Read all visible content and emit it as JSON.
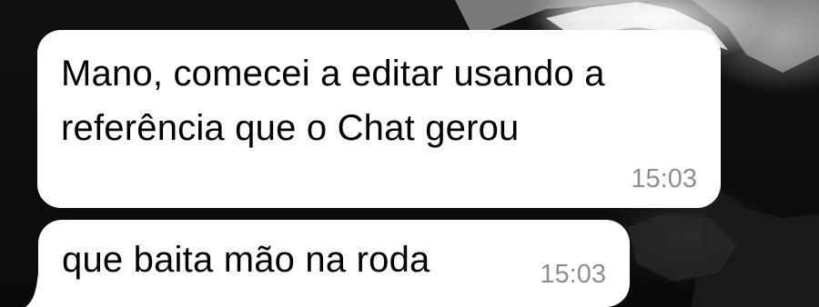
{
  "conversation": {
    "messages": [
      {
        "text_line1": "Mano, comecei a editar usando a",
        "text_line2": "referência que o Chat gerou",
        "time": "15:03"
      },
      {
        "text": "que baita mão na roda",
        "time": "15:03"
      }
    ]
  },
  "colors": {
    "bubble": "#ffffff",
    "timestamp": "#8e8e8e",
    "wallpaper": "#0b0b0b"
  },
  "icons": {
    "wallpaper": "snowy-mountain-wallpaper"
  }
}
